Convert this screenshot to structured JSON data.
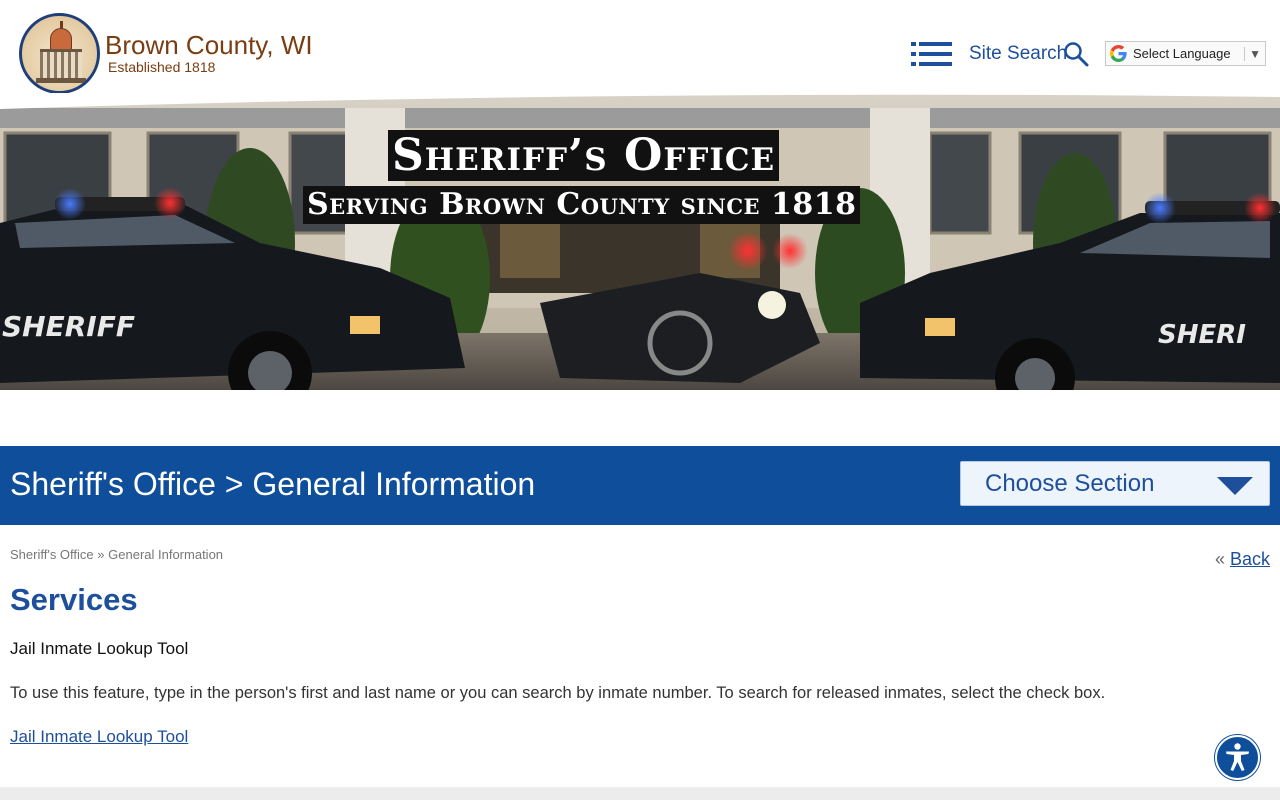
{
  "site": {
    "name": "Brown County, WI",
    "established": "Established 1818",
    "logo_icon": "county-seal-icon"
  },
  "header": {
    "menu_icon": "hamburger-menu-icon",
    "site_search_label": "Site Search",
    "search_icon": "search-icon",
    "language_label": "Select Language",
    "language_arrow": "▼"
  },
  "banner": {
    "title": "Sheriff’s Office",
    "subtitle": "Serving Brown County since 1818"
  },
  "section_bar": {
    "title": "Sheriff's Office > General Information",
    "choose_label": "Choose Section",
    "background": "#0f4e9a"
  },
  "breadcrumb": {
    "items": [
      "Sheriff's Office",
      "General Information"
    ],
    "separator": "»"
  },
  "back": {
    "prefix": "«",
    "label": "Back"
  },
  "content": {
    "title": "Services",
    "subheading": "Jail Inmate Lookup Tool",
    "description": "To use this feature, type in the person's first and last name or you can search by inmate number. To search for released inmates, select the check box.",
    "link_label": "Jail Inmate Lookup Tool"
  },
  "accessibility": {
    "icon": "accessibility-icon"
  },
  "colors": {
    "brand_blue": "#1e4f9c",
    "brand_brown": "#7a3d12"
  }
}
